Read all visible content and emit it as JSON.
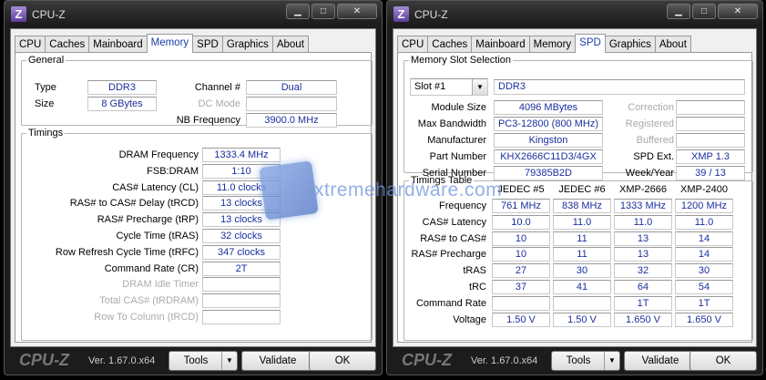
{
  "left": {
    "title": "CPU-Z",
    "tabs": [
      "CPU",
      "Caches",
      "Mainboard",
      "Memory",
      "SPD",
      "Graphics",
      "About"
    ],
    "active_tab": "Memory",
    "general": {
      "legend": "General",
      "type_label": "Type",
      "type_value": "DDR3",
      "size_label": "Size",
      "size_value": "8 GBytes",
      "channel_label": "Channel #",
      "channel_value": "Dual",
      "dcmode_label": "DC Mode",
      "dcmode_value": "",
      "nbfreq_label": "NB Frequency",
      "nbfreq_value": "3900.0 MHz"
    },
    "timings": {
      "legend": "Timings",
      "rows": [
        {
          "label": "DRAM Frequency",
          "value": "1333.4 MHz",
          "dim": false
        },
        {
          "label": "FSB:DRAM",
          "value": "1:10",
          "dim": false
        },
        {
          "label": "CAS# Latency (CL)",
          "value": "11.0 clocks",
          "dim": false
        },
        {
          "label": "RAS# to CAS# Delay (tRCD)",
          "value": "13 clocks",
          "dim": false
        },
        {
          "label": "RAS# Precharge (tRP)",
          "value": "13 clocks",
          "dim": false
        },
        {
          "label": "Cycle Time (tRAS)",
          "value": "32 clocks",
          "dim": false
        },
        {
          "label": "Row Refresh Cycle Time (tRFC)",
          "value": "347 clocks",
          "dim": false
        },
        {
          "label": "Command Rate (CR)",
          "value": "2T",
          "dim": false
        },
        {
          "label": "DRAM Idle Timer",
          "value": "",
          "dim": true
        },
        {
          "label": "Total CAS# (tRDRAM)",
          "value": "",
          "dim": true
        },
        {
          "label": "Row To Column (tRCD)",
          "value": "",
          "dim": true
        }
      ]
    },
    "brand": "CPU-Z",
    "version": "Ver. 1.67.0.x64",
    "tools": "Tools",
    "validate": "Validate",
    "ok": "OK"
  },
  "right": {
    "title": "CPU-Z",
    "tabs": [
      "CPU",
      "Caches",
      "Mainboard",
      "Memory",
      "SPD",
      "Graphics",
      "About"
    ],
    "active_tab": "SPD",
    "slot": {
      "legend": "Memory Slot Selection",
      "selected": "Slot #1",
      "type": "DDR3",
      "left_rows": [
        {
          "label": "Module Size",
          "value": "4096 MBytes"
        },
        {
          "label": "Max Bandwidth",
          "value": "PC3-12800 (800 MHz)"
        },
        {
          "label": "Manufacturer",
          "value": "Kingston"
        },
        {
          "label": "Part Number",
          "value": "KHX2666C11D3/4GX"
        },
        {
          "label": "Serial Number",
          "value": "79385B2D"
        }
      ],
      "right_rows": [
        {
          "label": "Correction",
          "value": "",
          "dim": true
        },
        {
          "label": "Registered",
          "value": "",
          "dim": true
        },
        {
          "label": "Buffered",
          "value": "",
          "dim": true
        },
        {
          "label": "SPD Ext.",
          "value": "XMP 1.3",
          "dim": false
        },
        {
          "label": "Week/Year",
          "value": "39 / 13",
          "dim": false
        }
      ]
    },
    "timings_table": {
      "legend": "Timings Table",
      "columns": [
        "JEDEC #5",
        "JEDEC #6",
        "XMP-2666",
        "XMP-2400"
      ],
      "rows": [
        {
          "label": "Frequency",
          "cells": [
            "761 MHz",
            "838 MHz",
            "1333 MHz",
            "1200 MHz"
          ]
        },
        {
          "label": "CAS# Latency",
          "cells": [
            "10.0",
            "11.0",
            "11.0",
            "11.0"
          ]
        },
        {
          "label": "RAS# to CAS#",
          "cells": [
            "10",
            "11",
            "13",
            "14"
          ]
        },
        {
          "label": "RAS# Precharge",
          "cells": [
            "10",
            "11",
            "13",
            "14"
          ]
        },
        {
          "label": "tRAS",
          "cells": [
            "27",
            "30",
            "32",
            "30"
          ]
        },
        {
          "label": "tRC",
          "cells": [
            "37",
            "41",
            "64",
            "54"
          ]
        },
        {
          "label": "Command Rate",
          "cells": [
            "",
            "",
            "1T",
            "1T"
          ]
        },
        {
          "label": "Voltage",
          "cells": [
            "1.50 V",
            "1.50 V",
            "1.650 V",
            "1.650 V"
          ]
        }
      ]
    },
    "brand": "CPU-Z",
    "version": "Ver. 1.67.0.x64",
    "tools": "Tools",
    "validate": "Validate",
    "ok": "OK"
  },
  "watermark": "xtremehardware.com",
  "value_color": "#1a2f9e"
}
